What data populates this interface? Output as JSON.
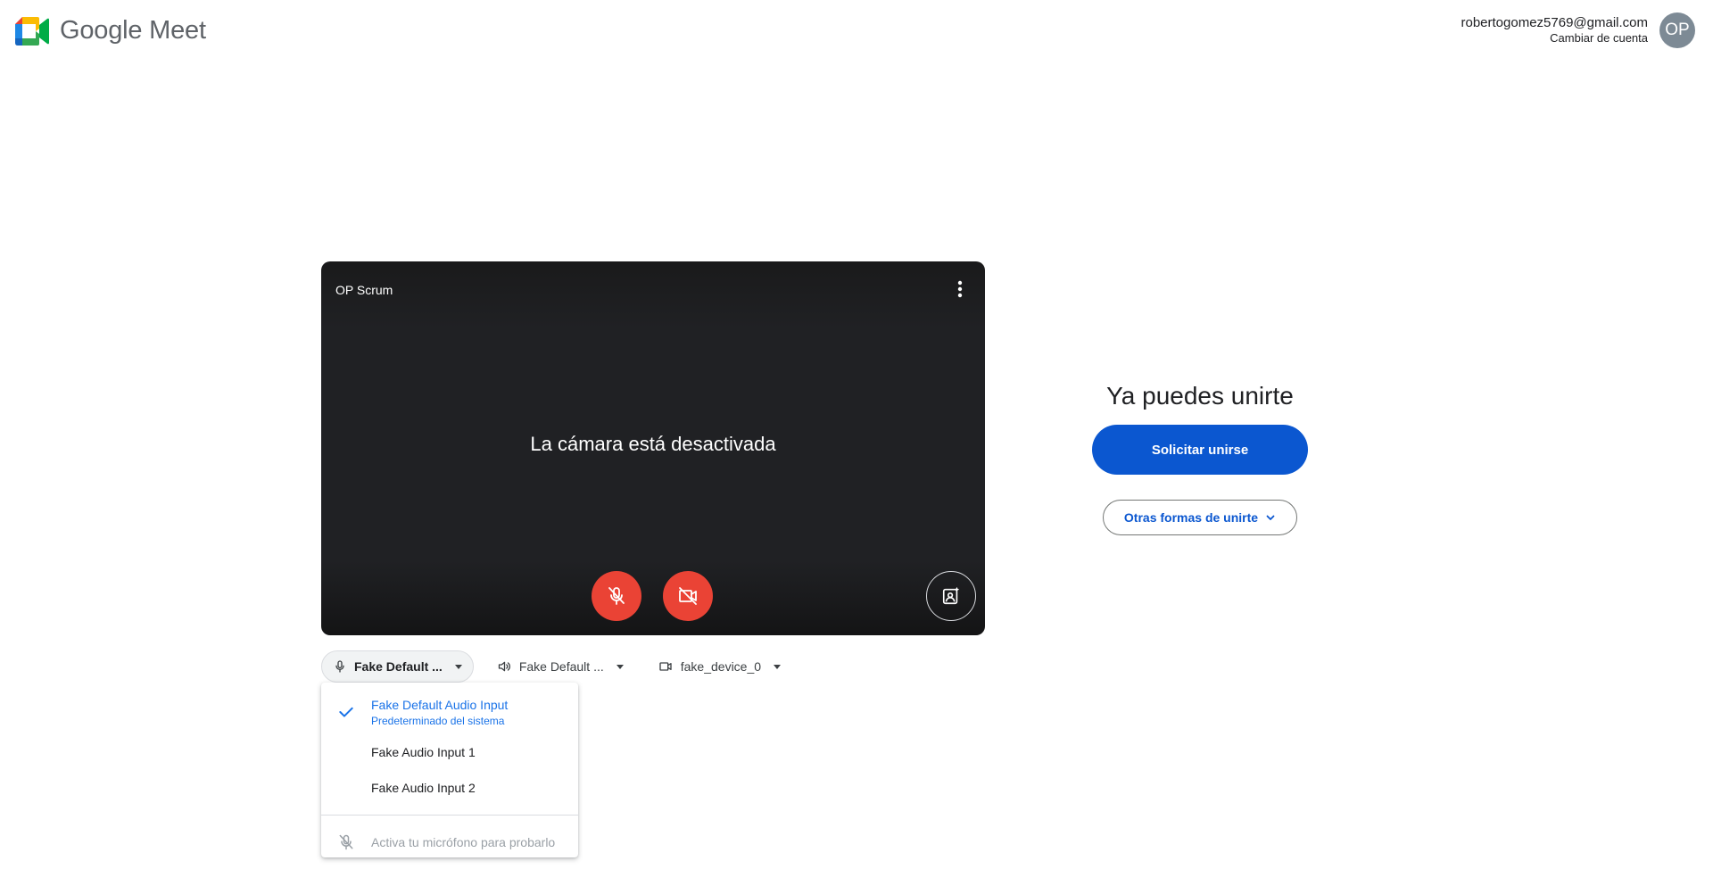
{
  "header": {
    "logo_text": "Google Meet",
    "account_email": "robertogomez5769@gmail.com",
    "switch_account": "Cambiar de cuenta",
    "avatar_initials": "OP",
    "avatar_color": "#7d8a95"
  },
  "preview": {
    "meeting_name": "OP Scrum",
    "camera_off_text": "La cámara está desactivada",
    "mic_button_icon": "mic-off-icon",
    "camera_button_icon": "videocam-off-icon",
    "effects_button_icon": "visual-effects-icon",
    "button_color": "#ea4335"
  },
  "devices": {
    "microphone": {
      "label": "Fake Default ...",
      "icon": "mic-icon"
    },
    "speaker": {
      "label": "Fake Default ...",
      "icon": "speaker-icon"
    },
    "camera": {
      "label": "fake_device_0",
      "icon": "videocam-icon"
    }
  },
  "mic_menu": {
    "items": [
      {
        "label": "Fake Default Audio Input",
        "sublabel": "Predeterminado del sistema",
        "selected": true
      },
      {
        "label": "Fake Audio Input 1",
        "selected": false
      },
      {
        "label": "Fake Audio Input 2",
        "selected": false
      }
    ],
    "footer": "Activa tu micrófono para probarlo"
  },
  "join": {
    "title": "Ya puedes unirte",
    "join_button": "Solicitar unirse",
    "other_ways_button": "Otras formas de unirte",
    "accent_color": "#0b57d0"
  }
}
